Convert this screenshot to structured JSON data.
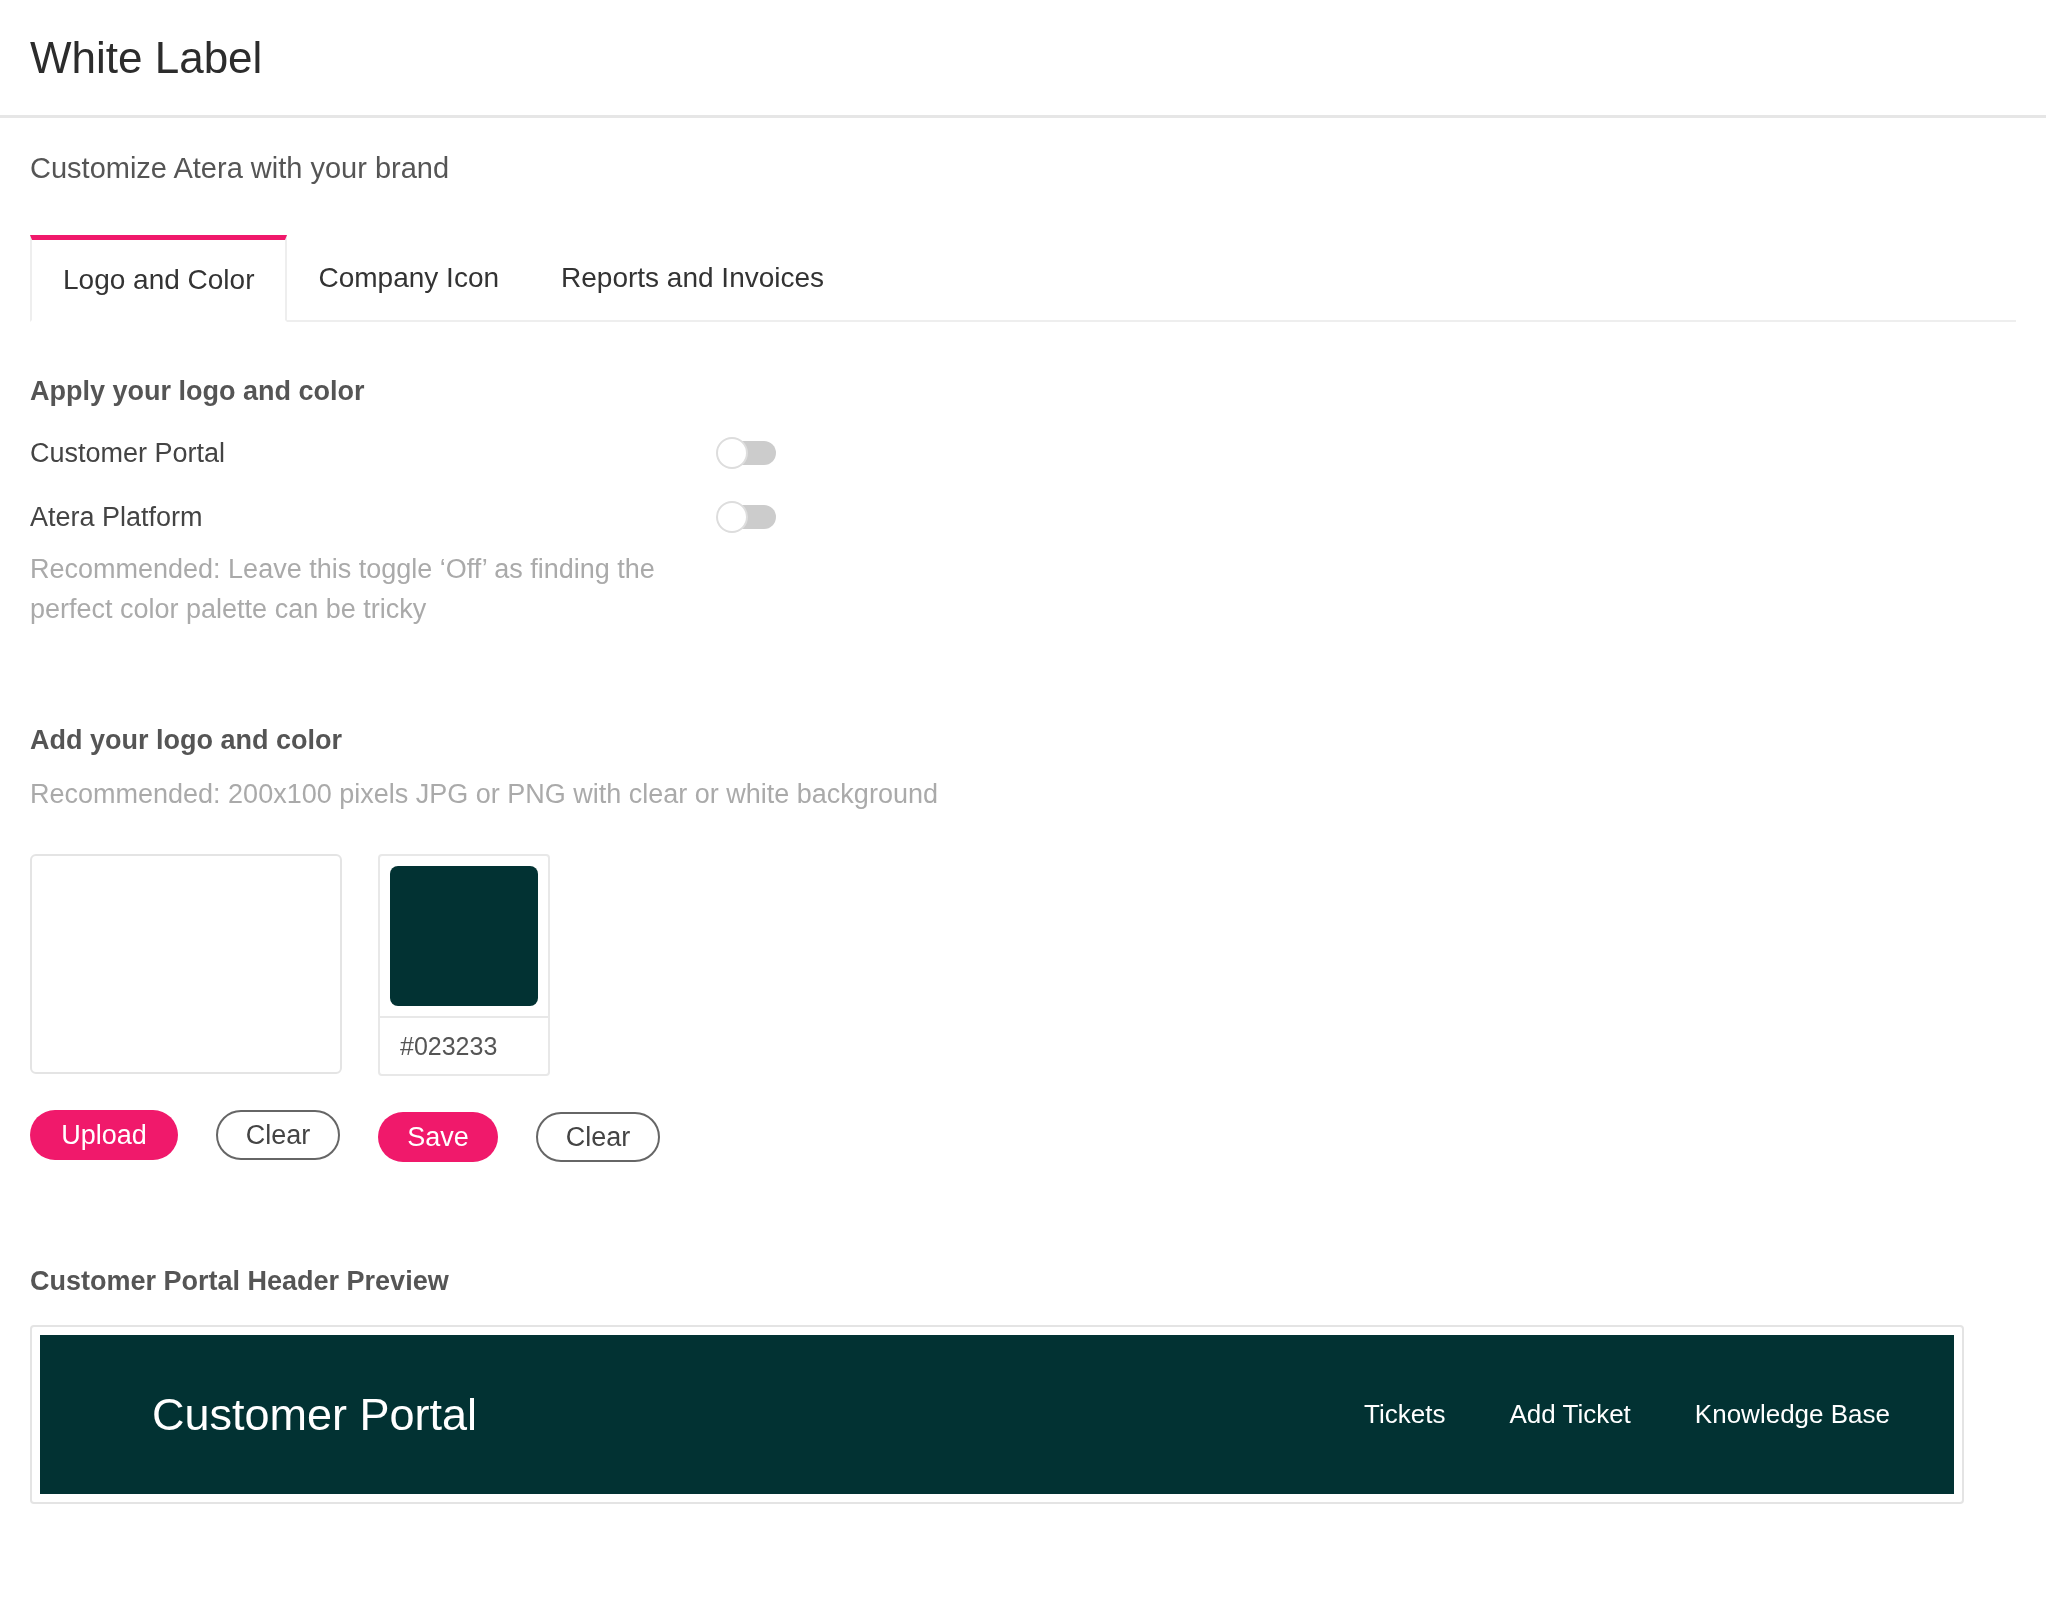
{
  "page": {
    "title": "White Label",
    "subtitle": "Customize Atera with your brand"
  },
  "tabs": [
    {
      "label": "Logo and Color",
      "selected": true
    },
    {
      "label": "Company Icon",
      "selected": false
    },
    {
      "label": "Reports and Invoices",
      "selected": false
    }
  ],
  "apply_section": {
    "heading": "Apply your logo and color",
    "toggles": [
      {
        "label": "Customer Portal",
        "on": false
      },
      {
        "label": "Atera Platform",
        "on": false
      }
    ],
    "note": "Recommended: Leave this toggle ‘Off’ as finding the perfect color palette can be tricky"
  },
  "add_section": {
    "heading": "Add your logo and color",
    "note": "Recommended: 200x100 pixels JPG or PNG with clear or white background",
    "color_value": "#023233",
    "logo_buttons": [
      "Upload",
      "Clear"
    ],
    "color_buttons": [
      "Save",
      "Clear"
    ]
  },
  "preview": {
    "heading": "Customer Portal Header Preview",
    "brand": "Customer Portal",
    "nav": [
      "Tickets",
      "Add Ticket",
      "Knowledge Base"
    ]
  }
}
